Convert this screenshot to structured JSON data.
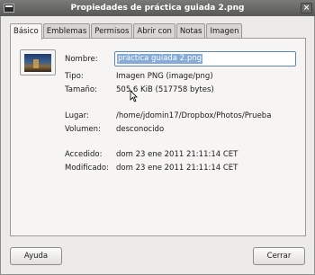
{
  "window": {
    "title": "Propiedades de práctica guiada 2.png"
  },
  "tabs": [
    {
      "label": "Básico"
    },
    {
      "label": "Emblemas"
    },
    {
      "label": "Permisos"
    },
    {
      "label": "Abrir con"
    },
    {
      "label": "Notas"
    },
    {
      "label": "Imagen"
    }
  ],
  "fields": {
    "name_label": "Nombre:",
    "name_value": "práctica guiada 2.png",
    "type_label": "Tipo:",
    "type_value": "Imagen PNG (image/png)",
    "size_label": "Tamaño:",
    "size_value": "505,6 KiB (517758 bytes)",
    "location_label": "Lugar:",
    "location_value": "/home/jdomin17/Dropbox/Photos/Prueba",
    "volume_label": "Volumen:",
    "volume_value": "desconocido",
    "accessed_label": "Accedido:",
    "accessed_value": "dom 23 ene 2011 21:11:14 CET",
    "modified_label": "Modificado:",
    "modified_value": "dom 23 ene 2011 21:11:14 CET"
  },
  "buttons": {
    "help": "Ayuda",
    "close": "Cerrar"
  },
  "icons": {
    "window": "application-window-icon",
    "close": "close-icon",
    "thumbnail": "image-thumbnail",
    "pointer": "mouse-pointer-icon"
  }
}
